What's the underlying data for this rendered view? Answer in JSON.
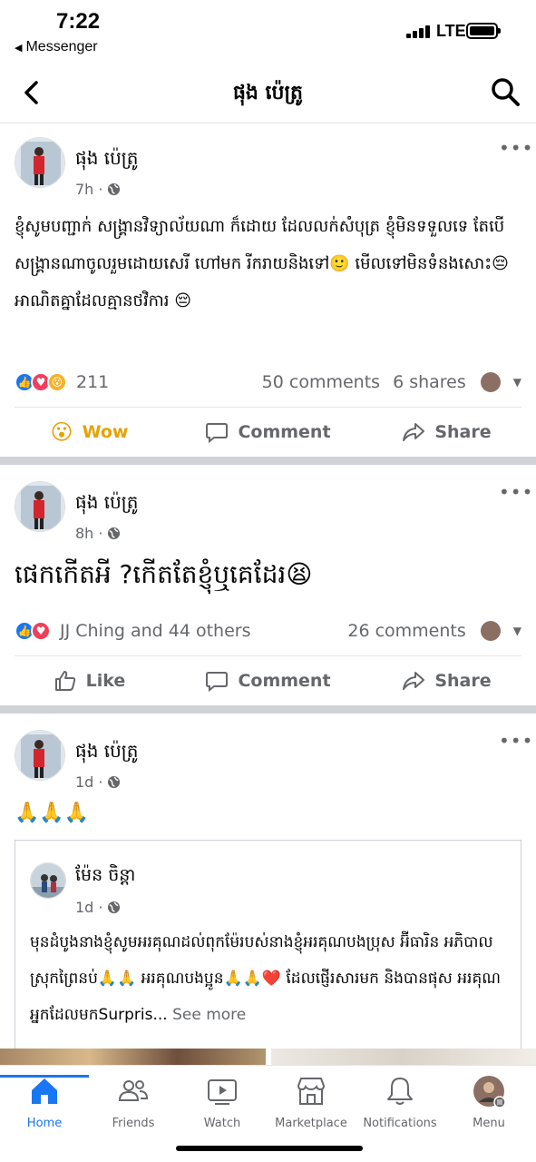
{
  "status_bar": {
    "time": "7:22",
    "back_app": "Messenger",
    "network": "LTE"
  },
  "header": {
    "title": "ផុង ប៉េត្រូ"
  },
  "posts": [
    {
      "author": "ផុង ប៉េត្រូ",
      "time": "7h",
      "text": "ខ្ញុំសូមបញ្ជាក់ សង្គ្រានវិទ្យាល័យណា ក៏ដោយ ដែលលក់សំបុត្រ ខ្ញុំមិនទទួលទេ តែបើសង្គ្រានណាចូលរួមដោយសេរី ហៅមក រីករាយនិងទៅ🙂 មើលទៅមិនទំនងសោះ😔 អាណិតគ្នាដែលគ្មានថវិការ 😔",
      "reaction_count": "211",
      "comments": "50 comments",
      "shares": "6 shares",
      "actions": {
        "react": "Wow",
        "comment": "Comment",
        "share": "Share"
      }
    },
    {
      "author": "ផុង ប៉េត្រូ",
      "time": "8h",
      "text": "ផេកកើតអី ?កើតតែខ្ញុំឬគេដែរ😫",
      "reaction_summary": "JJ Ching and 44 others",
      "comments": "26 comments",
      "actions": {
        "react": "Like",
        "comment": "Comment",
        "share": "Share"
      }
    },
    {
      "author": "ផុង ប៉េត្រូ",
      "time": "1d",
      "text": "🙏🙏🙏",
      "shared": {
        "author": "ម៉ែន ចិន្តា",
        "time": "1d",
        "text": "មុនដំបូងនាងខ្ញុំសូមអរគុណដល់ពុកម៉ែរបស់នាងខ្ញុំអរគុណបងប្រុស អ៊ីធារិន អភិបាលស្រុកព្រៃនប់🙏🙏 អរគុណបងប្អូន🙏🙏❤️ ដែលផ្ញើរសារមក និងបានផុស អរគុណអ្នកដែលមកSurpris...",
        "see_more": "See more"
      }
    }
  ],
  "tabs": [
    {
      "label": "Home",
      "icon": "home-icon"
    },
    {
      "label": "Friends",
      "icon": "friends-icon"
    },
    {
      "label": "Watch",
      "icon": "watch-icon"
    },
    {
      "label": "Marketplace",
      "icon": "marketplace-icon"
    },
    {
      "label": "Notifications",
      "icon": "bell-icon"
    },
    {
      "label": "Menu",
      "icon": "menu-avatar-icon"
    }
  ],
  "colors": {
    "accent": "#1877f2",
    "wow": "#e8a100",
    "muted": "#65676b",
    "separator": "#cfd3d7"
  }
}
